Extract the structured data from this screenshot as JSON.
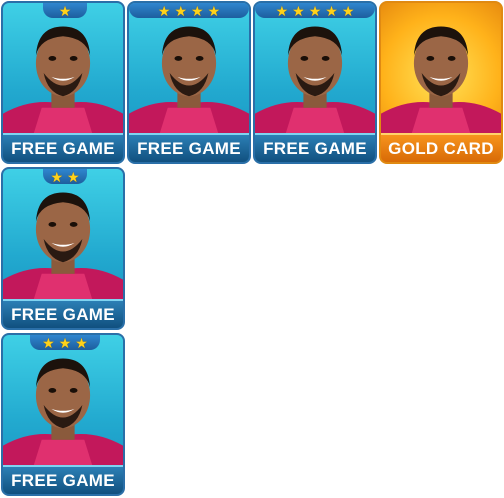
{
  "cards": [
    {
      "stars": 1,
      "label": "FREE GAME",
      "kind": "free"
    },
    {
      "stars": 4,
      "label": "FREE GAME",
      "kind": "free"
    },
    {
      "stars": 5,
      "label": "FREE GAME",
      "kind": "free"
    },
    {
      "stars": 0,
      "label": "GOLD CARD",
      "kind": "gold"
    },
    {
      "stars": 2,
      "label": "FREE GAME",
      "kind": "free"
    },
    {
      "stars": 3,
      "label": "FREE GAME",
      "kind": "free"
    }
  ],
  "colors": {
    "free_background": "#22a9cf",
    "gold_background": "#ffb21a",
    "free_label_bar": "#1d5e9e",
    "gold_label_bar": "#f7941d",
    "star": "#ffd21a"
  }
}
